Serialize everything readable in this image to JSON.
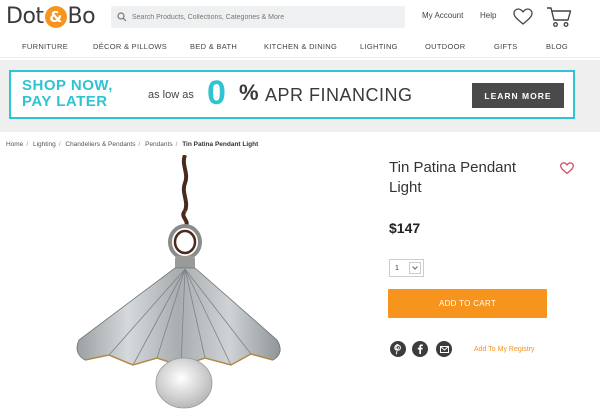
{
  "header": {
    "logo_left": "Dot",
    "logo_amp": "&",
    "logo_right": "Bo",
    "search_placeholder": "Search Products, Collections, Categories & More",
    "my_account": "My Account",
    "help": "Help",
    "wishlist_icon": "heart-icon",
    "cart_icon": "cart-icon"
  },
  "nav": {
    "items": [
      "FURNITURE",
      "DÉCOR & PILLOWS",
      "BED & BATH",
      "KITCHEN & DINING",
      "LIGHTING",
      "OUTDOOR",
      "GIFTS",
      "BLOG"
    ]
  },
  "banner": {
    "line1": "SHOP NOW,",
    "line2": "PAY LATER",
    "as_low_as": "as low as",
    "zero": "0",
    "percent": "%",
    "apr": "APR FINANCING",
    "cta": "LEARN MORE"
  },
  "breadcrumb": [
    "Home",
    "Lighting",
    "Chandeliers & Pendants",
    "Pendants",
    "Tin Patina Pendant Light"
  ],
  "product": {
    "title": "Tin Patina Pendant Light",
    "price": "$147",
    "quantity": "1",
    "add_to_cart": "ADD TO CART",
    "add_to_registry": "Add To My Registry",
    "social_icons": [
      "pinterest-icon",
      "facebook-icon",
      "email-icon"
    ]
  },
  "colors": {
    "accent_orange": "#f7941d",
    "banner_teal": "#2ec4d2",
    "dark_button": "#4a4a4a",
    "favorite_heart": "#d9435f"
  }
}
